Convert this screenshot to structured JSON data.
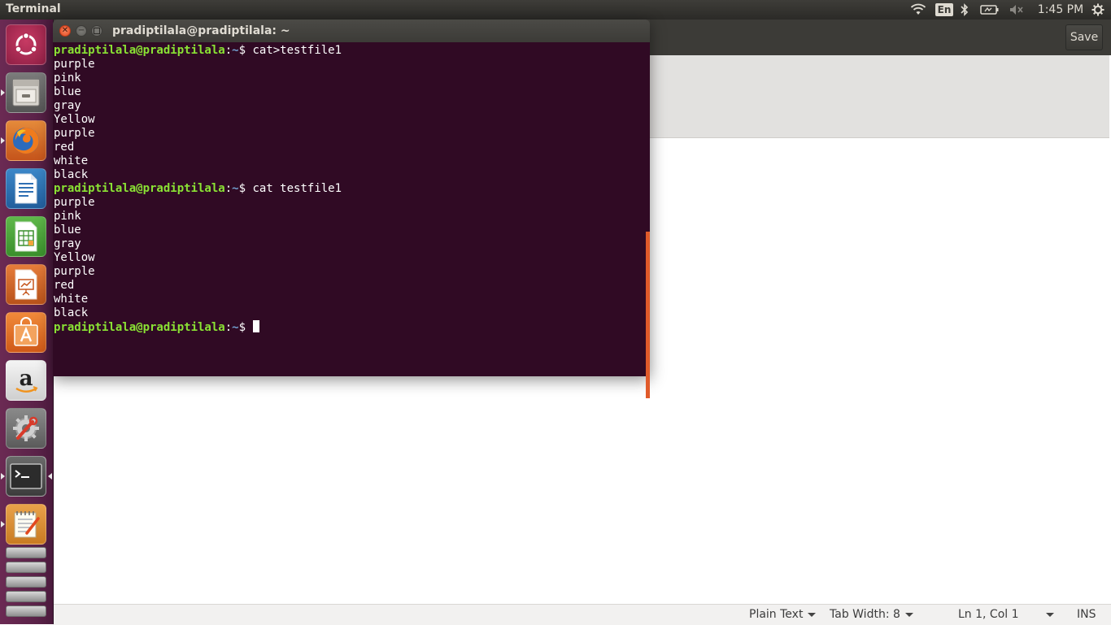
{
  "top_panel": {
    "app_title": "Terminal",
    "keyboard_layout": "En",
    "clock": "1:45 PM",
    "tray_icons": [
      "wifi-icon",
      "keyboard-layout-indicator",
      "bluetooth-icon",
      "battery-icon",
      "volume-muted-icon",
      "gear-icon"
    ]
  },
  "launcher": {
    "items": [
      {
        "name": "dash-home",
        "icon": "ubuntu-logo-icon"
      },
      {
        "name": "files",
        "icon": "file-cabinet-icon"
      },
      {
        "name": "firefox",
        "icon": "firefox-icon"
      },
      {
        "name": "libreoffice-writer",
        "icon": "writer-document-icon"
      },
      {
        "name": "libreoffice-calc",
        "icon": "calc-spreadsheet-icon"
      },
      {
        "name": "libreoffice-impress",
        "icon": "impress-presentation-icon"
      },
      {
        "name": "ubuntu-software-center",
        "icon": "shopping-bag-icon"
      },
      {
        "name": "amazon",
        "icon": "amazon-icon"
      },
      {
        "name": "system-settings",
        "icon": "wrench-gear-icon"
      },
      {
        "name": "terminal",
        "icon": "terminal-icon"
      },
      {
        "name": "text-editor",
        "icon": "notepad-icon"
      },
      {
        "name": "workspace-switcher",
        "icon": "workspace-stack-icon"
      }
    ]
  },
  "terminal": {
    "title": "pradiptilala@pradiptilala: ~",
    "lines": [
      {
        "prompt": "pradiptilala@pradiptilala",
        "path": "~",
        "symbol": "$",
        "command": " cat>testfile1"
      },
      {
        "text": "purple"
      },
      {
        "text": "pink"
      },
      {
        "text": "blue"
      },
      {
        "text": "gray"
      },
      {
        "text": "Yellow"
      },
      {
        "text": "purple"
      },
      {
        "text": "red"
      },
      {
        "text": "white"
      },
      {
        "text": "black"
      },
      {
        "prompt": "pradiptilala@pradiptilala",
        "path": "~",
        "symbol": "$",
        "command": " cat testfile1"
      },
      {
        "text": "purple"
      },
      {
        "text": "pink"
      },
      {
        "text": "blue"
      },
      {
        "text": "gray"
      },
      {
        "text": "Yellow"
      },
      {
        "text": "purple"
      },
      {
        "text": "red"
      },
      {
        "text": "white"
      },
      {
        "text": "black"
      },
      {
        "prompt": "pradiptilala@pradiptilala",
        "path": "~",
        "symbol": "$",
        "command": " ",
        "cursor": true
      }
    ]
  },
  "gedit": {
    "save_label": "Save",
    "status": {
      "language": "Plain Text",
      "tab_width": "Tab Width: 8",
      "position": "Ln 1, Col 1",
      "mode": "INS"
    }
  },
  "colors": {
    "terminal_bg": "#300a24",
    "prompt_green": "#8ae234",
    "path_blue": "#729fcf",
    "close_button": "#f05b2f",
    "launcher_bg": "#5a2248",
    "panel_bg": "#3c3b37"
  }
}
